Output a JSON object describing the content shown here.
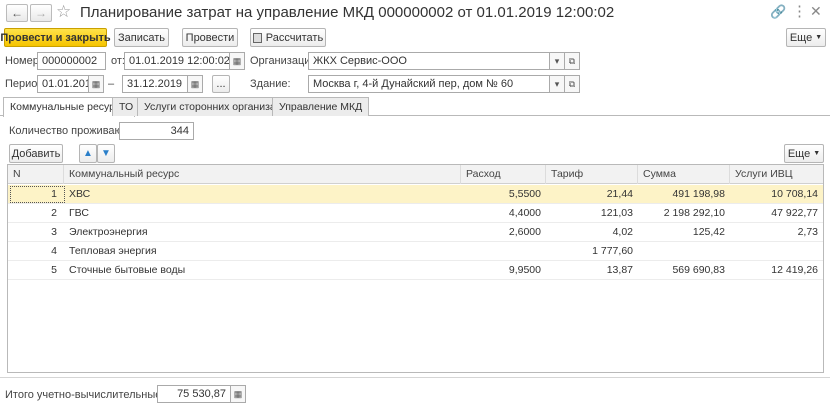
{
  "window": {
    "title": "Планирование затрат на управление МКД 000000002 от 01.01.2019 12:00:02"
  },
  "toolbar": {
    "post_close": "Провести и закрыть",
    "save": "Записать",
    "post": "Провести",
    "calculate": "Рассчитать",
    "more": "Еще"
  },
  "form": {
    "number_label": "Номер:",
    "number_value": "000000002",
    "from_label": "от:",
    "date_value": "01.01.2019 12:00:02",
    "org_label": "Организация:",
    "org_value": "ЖКХ Сервис-ООО",
    "period_label": "Период:",
    "period_start": "01.01.2019",
    "period_dash": "–",
    "period_end": "31.12.2019",
    "period_btn": "...",
    "building_label": "Здание:",
    "building_value": "Москва г, 4-й Дунайский пер, дом № 60"
  },
  "tabs": [
    {
      "label": "Коммунальные ресурсы"
    },
    {
      "label": "ТО"
    },
    {
      "label": "Услуги сторонних организаций"
    },
    {
      "label": "Управление МКД"
    }
  ],
  "tab_content": {
    "residents_label": "Количество проживающих:",
    "residents_value": "344",
    "add_btn": "Добавить",
    "more": "Еще"
  },
  "table": {
    "columns": [
      "N",
      "Коммунальный ресурс",
      "Расход",
      "Тариф",
      "Сумма",
      "Услуги ИВЦ"
    ],
    "rows": [
      {
        "n": "1",
        "resource": "ХВС",
        "consumption": "5,5500",
        "tariff": "21,44",
        "sum": "491 198,98",
        "ivc": "10 708,14"
      },
      {
        "n": "2",
        "resource": "ГВС",
        "consumption": "4,4000",
        "tariff": "121,03",
        "sum": "2 198 292,10",
        "ivc": "47 922,77"
      },
      {
        "n": "3",
        "resource": "Электроэнергия",
        "consumption": "2,6000",
        "tariff": "4,02",
        "sum": "125,42",
        "ivc": "2,73"
      },
      {
        "n": "4",
        "resource": "Тепловая энергия",
        "consumption": "",
        "tariff": "1 777,60",
        "sum": "",
        "ivc": ""
      },
      {
        "n": "5",
        "resource": "Сточные бытовые воды",
        "consumption": "9,9500",
        "tariff": "13,87",
        "sum": "569 690,83",
        "ivc": "12 419,26"
      }
    ]
  },
  "footer": {
    "label": "Итого учетно-вычислительные работы:",
    "value": "75 530,87"
  }
}
